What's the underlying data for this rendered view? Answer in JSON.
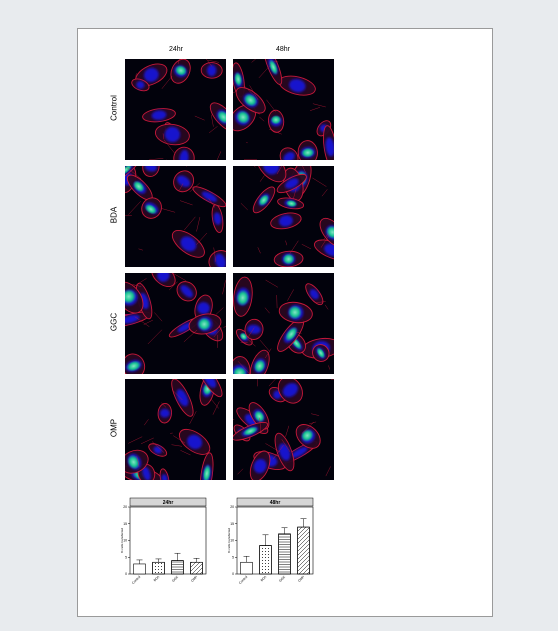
{
  "figure": {
    "columns": [
      "24hr",
      "48hr"
    ],
    "rows": [
      "Control",
      "BDA",
      "GGC",
      "OMP"
    ],
    "stain_colors": {
      "background": "#02020c",
      "nuclei": "#1414e0",
      "membrane": "#d21a3c",
      "marker": "#18d68a"
    }
  },
  "chart_data": [
    {
      "type": "bar",
      "title": "24hr",
      "categories": [
        "Control",
        "BDA",
        "GGC",
        "OMP"
      ],
      "values": [
        3.0,
        3.5,
        4.0,
        3.5
      ],
      "errors": [
        1.2,
        1.0,
        2.2,
        1.2
      ],
      "patterns": [
        "none",
        "dots",
        "hlines",
        "diagonal"
      ],
      "ylabel": "% cells transfected",
      "ylim": [
        0,
        20
      ],
      "yticks": [
        0,
        5,
        10,
        15,
        20
      ]
    },
    {
      "type": "bar",
      "title": "48hr",
      "categories": [
        "Control",
        "BDA",
        "GGC",
        "OMP"
      ],
      "values": [
        3.5,
        8.5,
        12.0,
        14.0
      ],
      "errors": [
        1.8,
        3.2,
        1.8,
        2.5
      ],
      "patterns": [
        "none",
        "dots",
        "hlines",
        "diagonal"
      ],
      "ylabel": "% cells transfected",
      "ylim": [
        0,
        20
      ],
      "yticks": [
        0,
        5,
        10,
        15,
        20
      ]
    }
  ]
}
